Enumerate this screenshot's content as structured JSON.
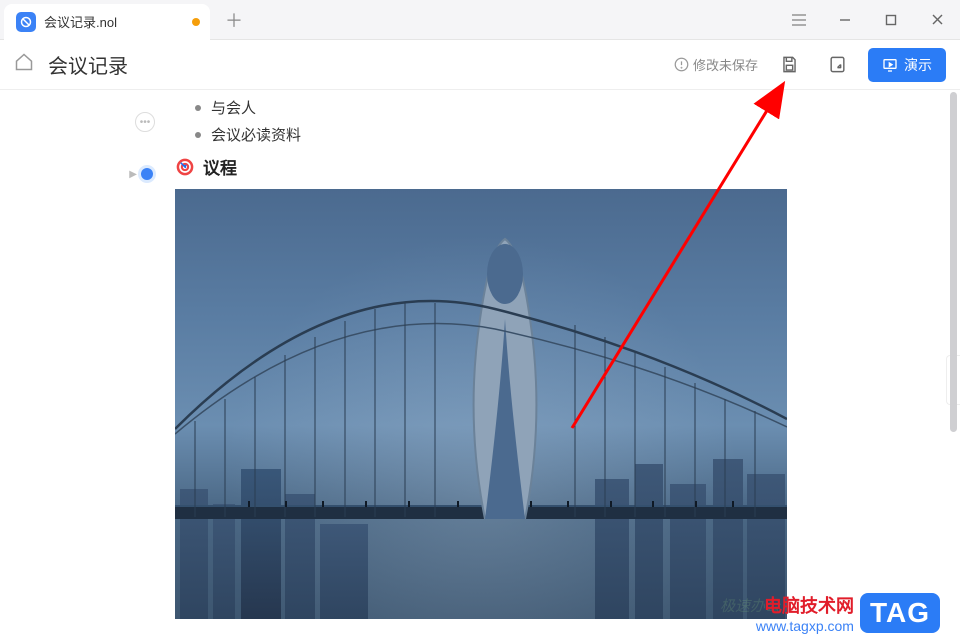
{
  "tab": {
    "title": "会议记录.nol"
  },
  "toolbar": {
    "doc_title": "会议记录",
    "unsaved_text": "修改未保存",
    "present_label": "演示"
  },
  "outline": {
    "items": [
      "与会人",
      "会议必读资料"
    ],
    "heading": "议程"
  },
  "watermark": {
    "line1": "电脑技术网",
    "line2": "www.tagxp.com",
    "badge": "TAG",
    "faint": "极速办公"
  }
}
